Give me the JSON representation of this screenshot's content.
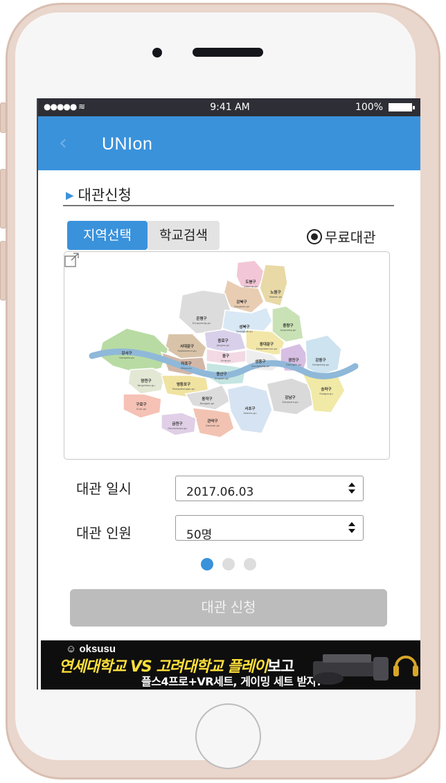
{
  "status_bar": {
    "signal": "●●●●● ",
    "time": "9:41 AM",
    "battery": "100%"
  },
  "header": {
    "back_glyph": "‹",
    "title": "UNIon"
  },
  "section": {
    "marker": "▶",
    "title": "대관신청"
  },
  "tabs": [
    {
      "label": "지역선택",
      "active": true
    },
    {
      "label": "학교검색",
      "active": false
    }
  ],
  "free_option": {
    "label": "무료대관",
    "selected": true
  },
  "map": {
    "districts": [
      {
        "ko": "도봉구",
        "en": "Dobong-gu",
        "color": "#f2c6d6"
      },
      {
        "ko": "노원구",
        "en": "Nowon-gu",
        "color": "#e8d9a6"
      },
      {
        "ko": "강북구",
        "en": "Gangbuk-gu",
        "color": "#e9cdb2"
      },
      {
        "ko": "은평구",
        "en": "Eunpyeong-gu",
        "color": "#dcdcdc"
      },
      {
        "ko": "성북구",
        "en": "Seongbuk-gu",
        "color": "#d9e8f5"
      },
      {
        "ko": "중랑구",
        "en": "Jungnang-gu",
        "color": "#c9e2b5"
      },
      {
        "ko": "종로구",
        "en": "Jongno-gu",
        "color": "#d8d0ea"
      },
      {
        "ko": "동대문구",
        "en": "Dongdaemun-gu",
        "color": "#f2e7a8"
      },
      {
        "ko": "서대문구",
        "en": "Seodaemun-gu",
        "color": "#d9c3a8"
      },
      {
        "ko": "강서구",
        "en": "Gangseo-gu",
        "color": "#b8dba3"
      },
      {
        "ko": "마포구",
        "en": "Mapo-gu",
        "color": "#d2b7a7"
      },
      {
        "ko": "중구",
        "en": "Jung-gu",
        "color": "#f2d9e3"
      },
      {
        "ko": "성동구",
        "en": "Seongdong-gu",
        "color": "#eeeeee"
      },
      {
        "ko": "광진구",
        "en": "Gwangjin-gu",
        "color": "#d7bfe3"
      },
      {
        "ko": "강동구",
        "en": "Gangdong-gu",
        "color": "#cde3ef"
      },
      {
        "ko": "용산구",
        "en": "Yongsan-gu",
        "color": "#c5e5e2"
      },
      {
        "ko": "양천구",
        "en": "Yangcheon-gu",
        "color": "#e3e8d4"
      },
      {
        "ko": "영등포구",
        "en": "Yeongdeungpo-gu",
        "color": "#f0e3a0"
      },
      {
        "ko": "동작구",
        "en": "Dongjak-gu",
        "color": "#dcdcdc"
      },
      {
        "ko": "구로구",
        "en": "Guro-gu",
        "color": "#f5c2b5"
      },
      {
        "ko": "서초구",
        "en": "Seocho-gu",
        "color": "#d6e3f2"
      },
      {
        "ko": "강남구",
        "en": "Gangnam-gu",
        "color": "#d9d9d9"
      },
      {
        "ko": "송파구",
        "en": "Songpa-gu",
        "color": "#f1e9a6"
      },
      {
        "ko": "관악구",
        "en": "Gwanak-gu",
        "color": "#f2c3b2"
      },
      {
        "ko": "금천구",
        "en": "Geumcheon-gu",
        "color": "#e0cfe6"
      }
    ],
    "river_color": "#8fb8d9"
  },
  "form": {
    "date_label": "대관 일시",
    "date_value": "2017.06.03",
    "people_label": "대관 인원",
    "people_value": "50명"
  },
  "pager": {
    "count": 3,
    "active": 0
  },
  "submit_label": "대관 신청",
  "ad": {
    "brand": "oksusu",
    "headline_yellow": "연세대학교 VS 고려대학교 플레이",
    "headline_white": "보고",
    "subline": "플스4프로+VR세트, 게이밍 세트 받자!"
  },
  "colors": {
    "accent": "#3a92db",
    "button_disabled": "#bcbcbc",
    "status_bar": "#2e2e36"
  }
}
